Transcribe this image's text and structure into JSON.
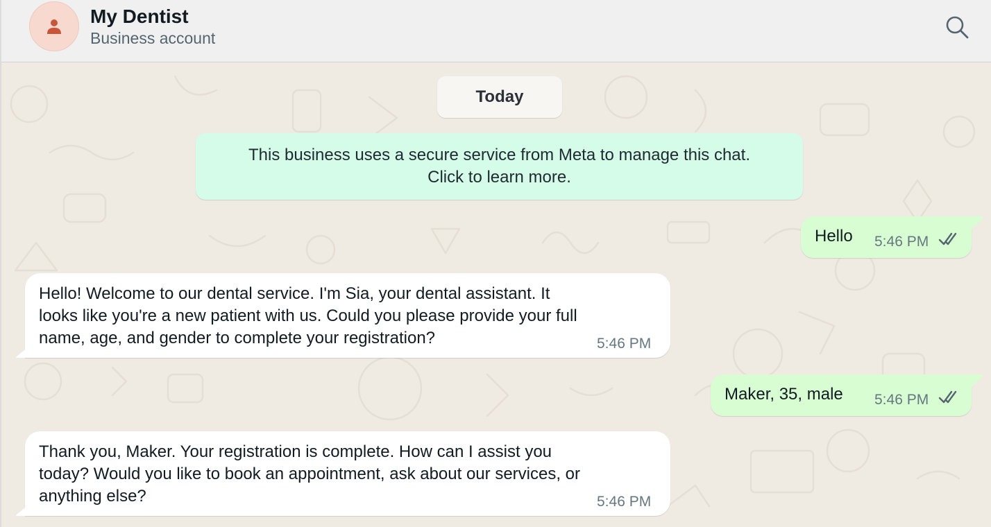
{
  "header": {
    "name": "My Dentist",
    "subtitle": "Business account",
    "avatar_icon": "person-icon",
    "search_icon": "search-icon"
  },
  "chat": {
    "date_label": "Today",
    "system_note": "This business uses a secure service from Meta to manage this chat.\nClick to learn more.",
    "messages": [
      {
        "direction": "outgoing",
        "text": "Hello",
        "time": "5:46 PM",
        "status": "read"
      },
      {
        "direction": "incoming",
        "text": "Hello! Welcome to our dental service. I'm Sia, your dental assistant. It\nlooks like you're a new patient with us. Could you please provide your full\nname, age, and gender to complete your registration?",
        "time": "5:46 PM"
      },
      {
        "direction": "outgoing",
        "text": "Maker, 35, male",
        "time": "5:46 PM",
        "status": "read"
      },
      {
        "direction": "incoming",
        "text": "Thank you, Maker. Your registration is complete. How can I assist you\ntoday? Would you like to book an appointment, ask about our services, or\nanything else?",
        "time": "5:46 PM"
      }
    ]
  },
  "colors": {
    "outgoing_bubble": "#d9fdd3",
    "incoming_bubble": "#ffffff",
    "system_note": "#d5fbe9",
    "chat_background": "#efeae2",
    "avatar_bg": "#f8d9cf",
    "avatar_icon": "#c8553a"
  }
}
